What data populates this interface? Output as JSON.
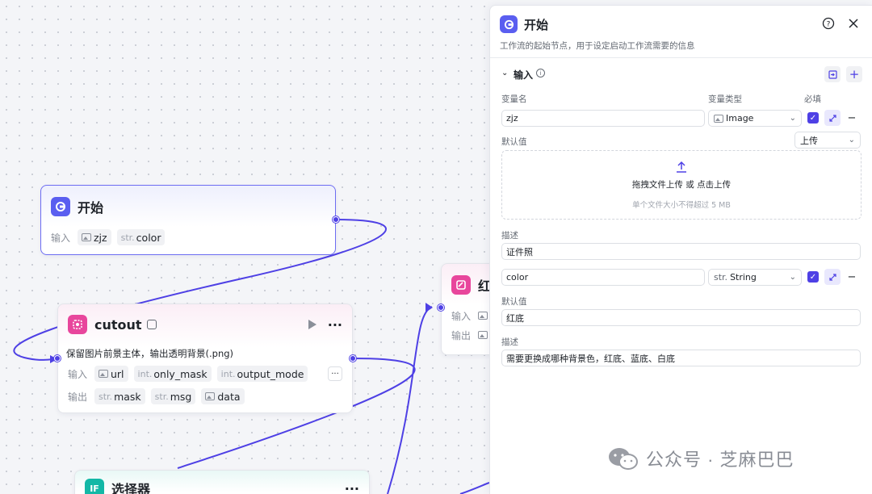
{
  "canvas": {
    "start_node": {
      "title": "开始",
      "input_label": "输入",
      "inputs": [
        {
          "type_prefix": "",
          "name": "zjz",
          "icon": "image-icon"
        },
        {
          "type_prefix": "str.",
          "name": "color",
          "icon": ""
        }
      ]
    },
    "cutout_node": {
      "title": "cutout",
      "description": "保留图片前景主体，输出透明背景(.png)",
      "input_label": "输入",
      "output_label": "输出",
      "inputs": [
        {
          "type_prefix": "",
          "name": "url",
          "icon": "image-icon"
        },
        {
          "type_prefix": "int.",
          "name": "only_mask",
          "icon": ""
        },
        {
          "type_prefix": "int.",
          "name": "output_mode",
          "icon": ""
        }
      ],
      "outputs": [
        {
          "type_prefix": "str.",
          "name": "mask",
          "icon": ""
        },
        {
          "type_prefix": "str.",
          "name": "msg",
          "icon": ""
        },
        {
          "type_prefix": "",
          "name": "data",
          "icon": "image-icon"
        }
      ],
      "more_label": "···"
    },
    "partial_node": {
      "title": "红",
      "input_label": "输入",
      "output_label": "输出"
    },
    "selector_node": {
      "title": "选择器",
      "icon_text": "IF",
      "more_label": "···"
    }
  },
  "panel": {
    "title": "开始",
    "description": "工作流的起始节点，用于设定启动工作流需要的信息",
    "section_title": "输入",
    "headers": {
      "name": "变量名",
      "type": "变量类型",
      "required": "必填"
    },
    "variables": [
      {
        "name": "zjz",
        "type_prefix": "",
        "type": "Image",
        "default_label": "默认值",
        "default_mode": "上传",
        "upload_text": "拖拽文件上传 或 点击上传",
        "upload_hint": "单个文件大小不得超过 5 MB",
        "desc_label": "描述",
        "description": "证件照"
      },
      {
        "name": "color",
        "type_prefix": "str.",
        "type": "String",
        "default_label": "默认值",
        "default_value": "红底",
        "desc_label": "描述",
        "description": "需要更换成哪种背景色，红底、蓝底、白底"
      }
    ]
  },
  "watermark": {
    "text": "公众号 · 芝麻巴巴"
  },
  "colors": {
    "accent": "#4e40e5",
    "start_icon": "#5a5ef0",
    "cutout_icon": "#e8469c",
    "selector_icon": "#13b8a6"
  }
}
